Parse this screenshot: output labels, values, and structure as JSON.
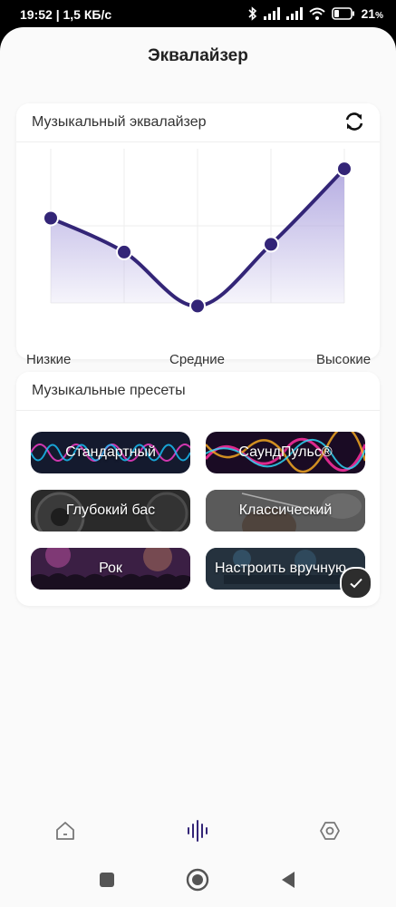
{
  "status_bar": {
    "time_speed": "19:52 | 1,5 КБ/с",
    "battery": "21",
    "battery_unit": "%",
    "icons": [
      "bluetooth-icon",
      "signal-icon",
      "signal-icon",
      "wifi-icon",
      "battery-icon"
    ]
  },
  "header": {
    "title": "Эквалайзер"
  },
  "equalizer": {
    "title": "Музыкальный эквалайзер",
    "reset_icon": "refresh-icon",
    "bands": {
      "low": "Низкие",
      "mid": "Средние",
      "high": "Высокие"
    },
    "levels": [
      0.55,
      0.33,
      -0.02,
      0.38,
      0.87
    ],
    "accent_color": "#332577",
    "fill_color": "#b1a8e0"
  },
  "presets": {
    "title": "Музыкальные пресеты",
    "items": [
      {
        "label": "Стандартный",
        "selected": false
      },
      {
        "label": "СаундПульс®",
        "selected": false
      },
      {
        "label": "Глубокий бас",
        "selected": false
      },
      {
        "label": "Классический",
        "selected": false
      },
      {
        "label": "Рок",
        "selected": false
      },
      {
        "label": "Настроить вручную",
        "selected": true
      }
    ],
    "selected_icon": "check-icon"
  },
  "bottom_nav": {
    "items": [
      {
        "icon": "home-icon",
        "active": false
      },
      {
        "icon": "equalizer-icon",
        "active": true
      },
      {
        "icon": "settings-icon",
        "active": false
      }
    ]
  },
  "system_nav": {
    "icons": [
      "recents-icon",
      "home-circle-icon",
      "back-icon"
    ]
  }
}
